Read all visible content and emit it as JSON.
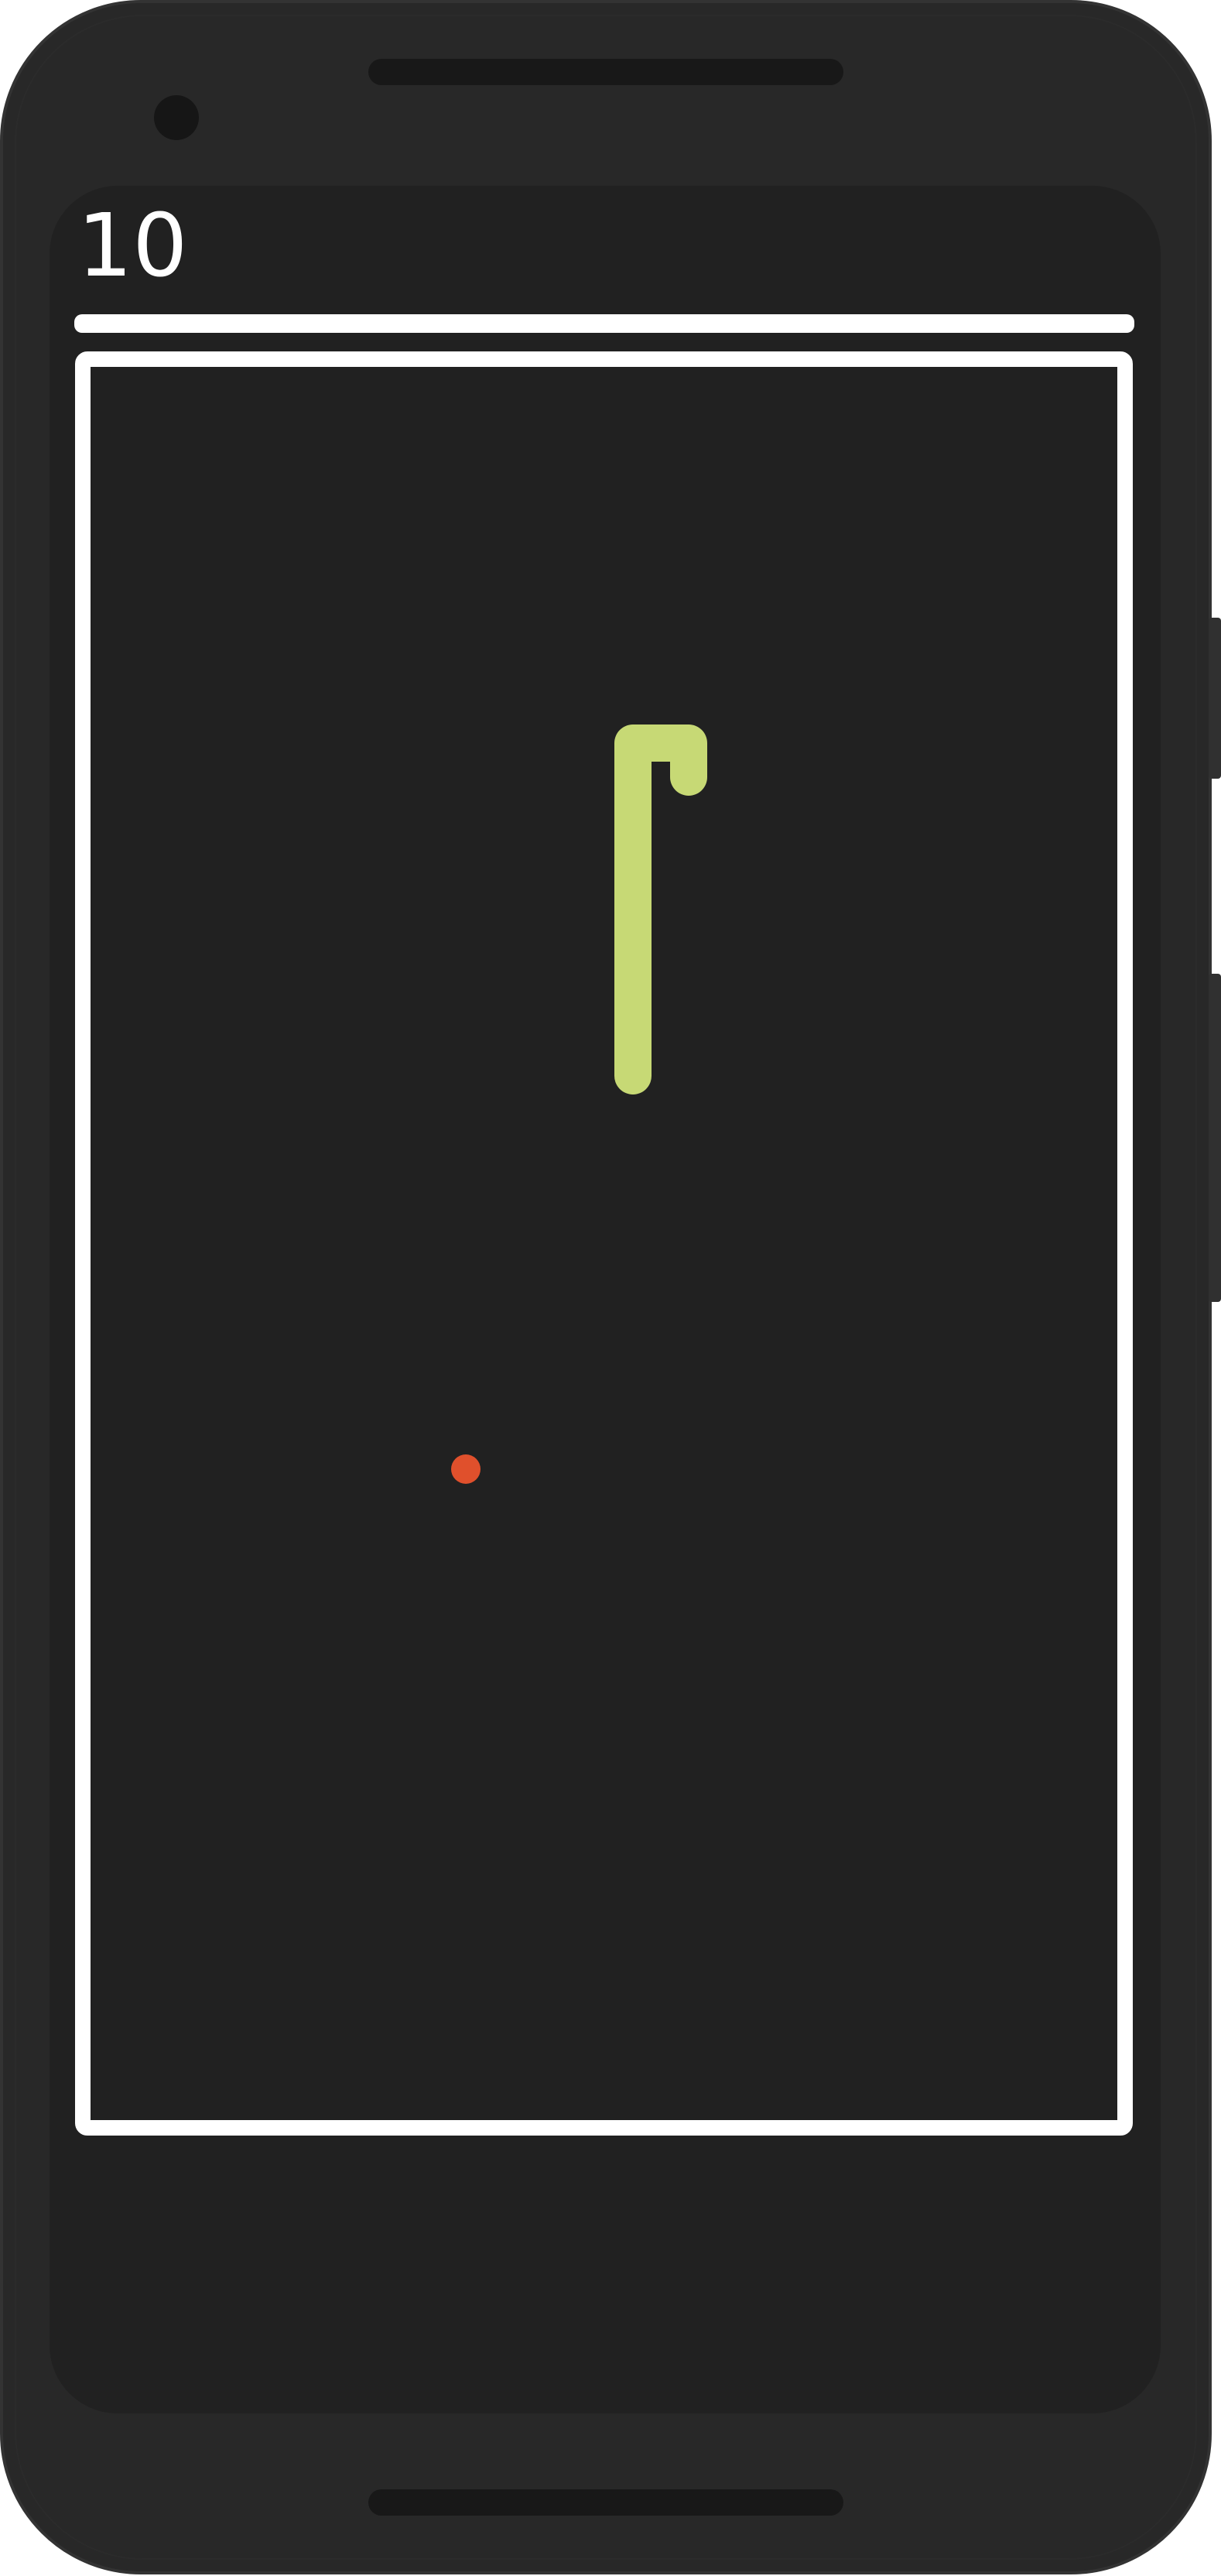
{
  "device": {
    "model": "phone",
    "frame_color": "#282828",
    "frame_border_color": "#333333",
    "screen_color": "#212121",
    "speaker_color": "#181818",
    "camera_color": "#161616",
    "side_button_color": "#303030"
  },
  "game": {
    "score": "10",
    "border_color": "#ffffff",
    "snake": {
      "color": "#c7d975"
    },
    "food": {
      "color": "#e0502c"
    }
  }
}
